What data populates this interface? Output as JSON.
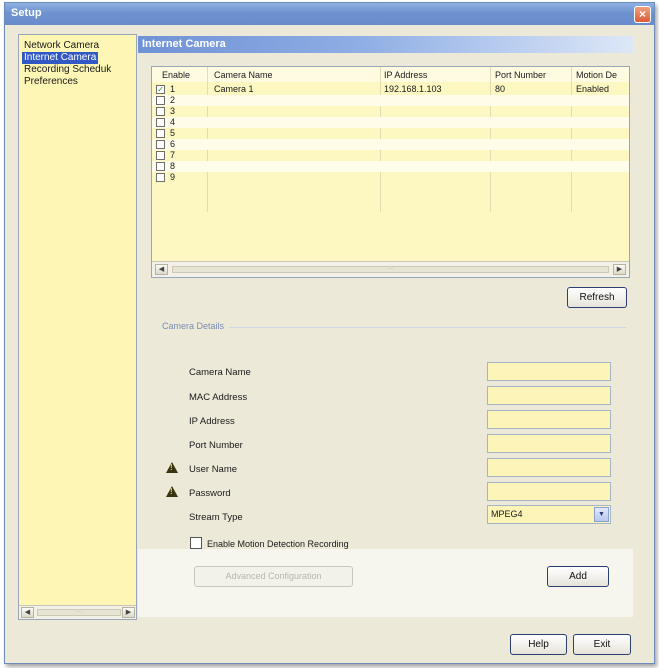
{
  "window": {
    "title": "Setup",
    "close_glyph": "×"
  },
  "sidebar": {
    "items": [
      {
        "label": "Network Camera",
        "selected": false
      },
      {
        "label": "Internet Camera",
        "selected": true
      },
      {
        "label": "Recording Scheduk",
        "selected": false
      },
      {
        "label": "Preferences",
        "selected": false
      }
    ]
  },
  "scroll": {
    "left": "◀",
    "right": "▶",
    "thumb": "····"
  },
  "panel": {
    "header": "Internet Camera"
  },
  "grid": {
    "columns": [
      "Enable",
      "Camera Name",
      "IP Address",
      "Port Number",
      "Motion De"
    ],
    "rows": [
      {
        "num": "1",
        "checked": true,
        "camera_name": "Camera 1",
        "ip": "192.168.1.103",
        "port": "80",
        "motion": "Enabled"
      },
      {
        "num": "2",
        "checked": false,
        "camera_name": "",
        "ip": "",
        "port": "",
        "motion": ""
      },
      {
        "num": "3",
        "checked": false,
        "camera_name": "",
        "ip": "",
        "port": "",
        "motion": ""
      },
      {
        "num": "4",
        "checked": false,
        "camera_name": "",
        "ip": "",
        "port": "",
        "motion": ""
      },
      {
        "num": "5",
        "checked": false,
        "camera_name": "",
        "ip": "",
        "port": "",
        "motion": ""
      },
      {
        "num": "6",
        "checked": false,
        "camera_name": "",
        "ip": "",
        "port": "",
        "motion": ""
      },
      {
        "num": "7",
        "checked": false,
        "camera_name": "",
        "ip": "",
        "port": "",
        "motion": ""
      },
      {
        "num": "8",
        "checked": false,
        "camera_name": "",
        "ip": "",
        "port": "",
        "motion": ""
      },
      {
        "num": "9",
        "checked": false,
        "camera_name": "",
        "ip": "",
        "port": "",
        "motion": ""
      }
    ],
    "check_glyph": "✓"
  },
  "buttons": {
    "refresh": "Refresh",
    "advanced": "Advanced Configuration",
    "add": "Add",
    "help": "Help",
    "exit": "Exit"
  },
  "details": {
    "section_label": "Camera Details",
    "fields": {
      "camera_name": {
        "label": "Camera Name",
        "value": ""
      },
      "mac_address": {
        "label": "MAC Address",
        "value": ""
      },
      "ip_address": {
        "label": "IP Address",
        "value": ""
      },
      "port_number": {
        "label": "Port Number",
        "value": ""
      },
      "user_name": {
        "label": "User Name",
        "value": ""
      },
      "password": {
        "label": "Password",
        "value": ""
      }
    },
    "stream_type": {
      "label": "Stream Type",
      "value": "MPEG4",
      "arrow": "▼"
    },
    "motion_checkbox": {
      "label": "Enable Motion Detection Recording",
      "checked": false
    }
  },
  "colors": {
    "title_bar": "#7a9bd9",
    "sidebar_bg": "#fdf6b4",
    "selection": "#3158c4",
    "input_bg": "#fdf5b8",
    "warning": "#f1c21d"
  }
}
